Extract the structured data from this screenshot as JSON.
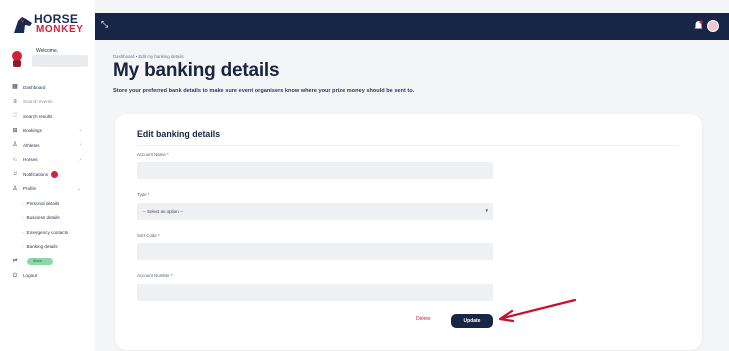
{
  "brand": {
    "line1": "HORSE",
    "line2": "MONKEY",
    "accent": "#d1233a",
    "navy": "#172647"
  },
  "user": {
    "welcome": "Welcome,"
  },
  "sidebar": {
    "items": [
      {
        "label": "Dashboard",
        "icon": "dashboard-icon"
      },
      {
        "label": "Search events",
        "icon": "list-icon"
      },
      {
        "label": "Search results",
        "icon": "heart-icon"
      },
      {
        "label": "Bookings",
        "icon": "bookings-icon"
      },
      {
        "label": "Athletes",
        "icon": "athlete-icon"
      },
      {
        "label": "Horses",
        "icon": "horse-icon"
      },
      {
        "label": "Notifications",
        "icon": "bell-icon"
      },
      {
        "label": "Profile",
        "icon": "profile-icon"
      }
    ],
    "profile_sub": [
      {
        "label": "Personal details"
      },
      {
        "label": "Business details"
      },
      {
        "label": "Emergency contacts"
      },
      {
        "label": "Banking details"
      }
    ],
    "toggle_label": "Show",
    "logout": "Logout"
  },
  "breadcrumb": {
    "home": "Dashboard",
    "sep": "•",
    "current": "Edit my banking details"
  },
  "page": {
    "title": "My banking details",
    "subtitle": "Store your preferred bank details to make sure event organisers know where your prize money should be sent to."
  },
  "form": {
    "title": "Edit banking details",
    "account_name_label": "Account Name *",
    "type_label": "Type *",
    "type_value": "-- Select an option --",
    "sort_code_label": "Sort Code *",
    "account_number_label": "Account Number *",
    "delete_label": "Delete",
    "update_label": "Update"
  }
}
